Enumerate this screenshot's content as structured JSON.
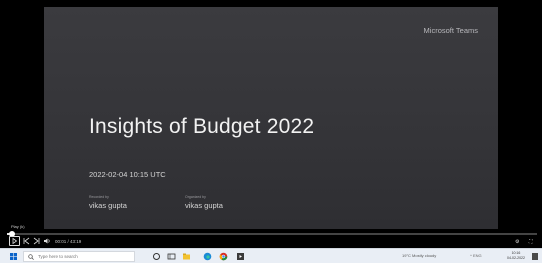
{
  "slide": {
    "brand": "Microsoft Teams",
    "title": "Insights of Budget 2022",
    "datetime": "2022-02-04 10:15 UTC",
    "recorded_by_label": "Recorded by",
    "recorded_by": "vikas gupta",
    "organized_by_label": "Organized by",
    "organized_by": "vikas gupta"
  },
  "player": {
    "tooltip": "Play (k)",
    "time": "00:01 / 43:19",
    "progress": 0.01
  },
  "taskbar": {
    "search_placeholder": "Type here to search",
    "weather": "19°C Mostly cloudy",
    "tray": "^ ENG",
    "clock_time": "10:16",
    "clock_date": "04-02-2022"
  }
}
